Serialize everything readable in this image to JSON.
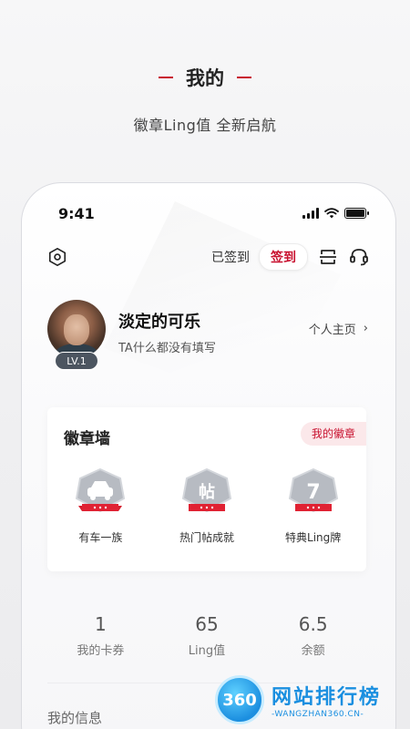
{
  "promo": {
    "title": "我的",
    "subtitle": "徽章Ling值  全新启航"
  },
  "status_bar": {
    "time": "9:41"
  },
  "header": {
    "signed_text": "已签到",
    "signin_label": "签到",
    "icons": [
      "settings-hex-icon",
      "scan-icon",
      "customer-service-icon"
    ]
  },
  "profile": {
    "level": "LV.1",
    "nickname": "淡定的可乐",
    "bio": "TA什么都没有填写",
    "home_link": "个人主页",
    "home_arrow": "›"
  },
  "badge_wall": {
    "title": "徽章墙",
    "my_badges_label": "我的徽章",
    "badges": [
      {
        "label": "有车一族",
        "icon": "car-badge-icon",
        "glyph": "🚗"
      },
      {
        "label": "热门帖成就",
        "icon": "hot-post-badge-icon",
        "glyph": "帖"
      },
      {
        "label": "特典Ling牌",
        "icon": "ling-card-badge-icon",
        "glyph": "7"
      }
    ],
    "colors": {
      "accent": "#c8102e",
      "badge_gray": "#a9adb5"
    }
  },
  "stats": [
    {
      "value": "1",
      "label": "我的卡券"
    },
    {
      "value": "65",
      "label": "Ling值"
    },
    {
      "value": "6.5",
      "label": "余额"
    }
  ],
  "sections": {
    "my_info_title": "我的信息"
  },
  "watermark": {
    "logo_text": "360",
    "title": "网站排行榜",
    "url": "-WANGZHAN360.CN-"
  }
}
